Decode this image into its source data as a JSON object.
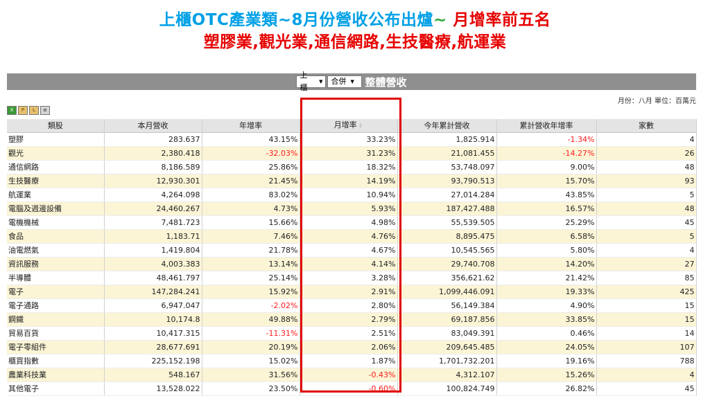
{
  "headline": {
    "line1_part1": "上櫃OTC產業類~8月份營收公布出爐",
    "line1_part2": "~",
    "line1_part3": " 月增率前五名",
    "line2": "塑膠業,觀光業,通信網路,生技醫療,航運業"
  },
  "toolbar": {
    "market_select": "上櫃",
    "report_select": "合併",
    "title": "整體營收"
  },
  "meta": "月份：八月 單位：百萬元",
  "tools": {
    "excel_glyph": "X",
    "pdf_glyph": "P",
    "lock_glyph": "L",
    "print_glyph": "≡"
  },
  "colors": {
    "headline_blue": "#00a0e6",
    "headline_green": "#2ea83a",
    "headline_red": "#e60000",
    "negative": "#ff1a1a",
    "row_alt": "#fbf5d6",
    "highlight": "#e00000"
  },
  "table": {
    "headers": [
      "類股",
      "本月營收",
      "年增率",
      "月增率",
      "今年累計營收",
      "累計營收年增率",
      "家數"
    ],
    "sort_indicator": "⇕",
    "rows": [
      [
        "塑膠",
        "283.637",
        "43.15%",
        "33.23%",
        "1,825.914",
        "-1.34%",
        "4"
      ],
      [
        "觀光",
        "2,380.418",
        "-32.03%",
        "31.23%",
        "21,081.455",
        "-14.27%",
        "26"
      ],
      [
        "通信網路",
        "8,186.589",
        "25.86%",
        "18.32%",
        "53,748.097",
        "9.00%",
        "48"
      ],
      [
        "生技醫療",
        "12,930.301",
        "21.45%",
        "14.19%",
        "93,790.513",
        "15.70%",
        "93"
      ],
      [
        "航運業",
        "4,264.098",
        "83.02%",
        "10.94%",
        "27,014.284",
        "43.85%",
        "5"
      ],
      [
        "電腦及週邊設備",
        "24,460.267",
        "4.73%",
        "5.93%",
        "187,427.488",
        "16.57%",
        "48"
      ],
      [
        "電機機械",
        "7,481.723",
        "15.66%",
        "4.98%",
        "55,539.505",
        "25.29%",
        "45"
      ],
      [
        "食品",
        "1,183.71",
        "7.46%",
        "4.76%",
        "8,895.475",
        "6.58%",
        "5"
      ],
      [
        "油電燃氣",
        "1,419.804",
        "21.78%",
        "4.67%",
        "10,545.565",
        "5.80%",
        "4"
      ],
      [
        "資訊服務",
        "4,003.383",
        "13.14%",
        "4.14%",
        "29,740.708",
        "14.20%",
        "27"
      ],
      [
        "半導體",
        "48,461.797",
        "25.14%",
        "3.28%",
        "356,621.62",
        "21.42%",
        "85"
      ],
      [
        "電子",
        "147,284.241",
        "15.92%",
        "2.91%",
        "1,099,446.091",
        "19.33%",
        "425"
      ],
      [
        "電子通路",
        "6,947.047",
        "-2.02%",
        "2.80%",
        "56,149.384",
        "4.90%",
        "15"
      ],
      [
        "鋼鐵",
        "10,174.8",
        "49.88%",
        "2.79%",
        "69,187.856",
        "33.85%",
        "15"
      ],
      [
        "貿易百貨",
        "10,417.315",
        "-11.31%",
        "2.51%",
        "83,049.391",
        "0.46%",
        "14"
      ],
      [
        "電子零組件",
        "28,677.691",
        "20.19%",
        "2.06%",
        "209,645.485",
        "24.05%",
        "107"
      ],
      [
        "櫃買指數",
        "225,152.198",
        "15.02%",
        "1.87%",
        "1,701,732.201",
        "19.16%",
        "788"
      ],
      [
        "農業科技業",
        "548.167",
        "31.56%",
        "-0.43%",
        "4,312.107",
        "15.26%",
        "4"
      ],
      [
        "其他電子",
        "13,528.022",
        "23.50%",
        "-0.60%",
        "100,824.749",
        "26.82%",
        "45"
      ]
    ]
  }
}
